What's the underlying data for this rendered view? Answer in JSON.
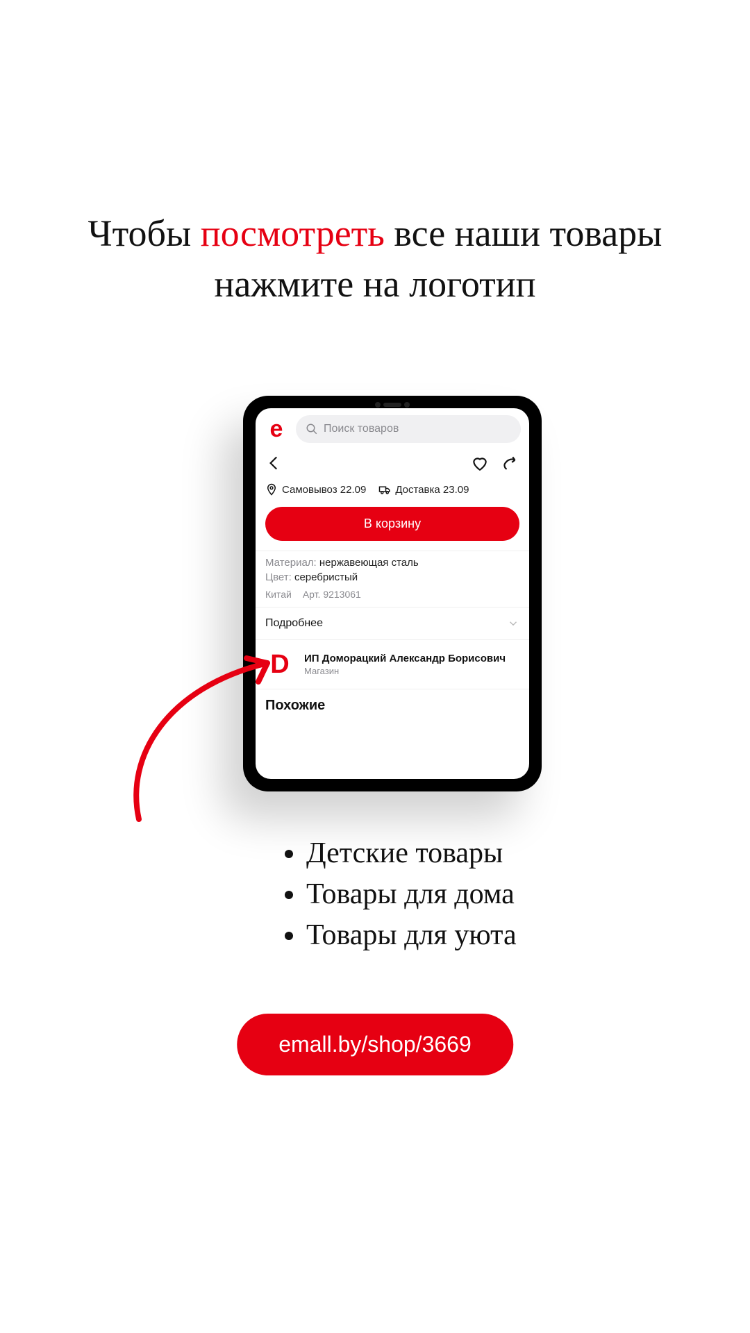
{
  "headline": {
    "part1": "Чтобы ",
    "accent": "посмотреть",
    "part2": " все наши товары",
    "line2": "нажмите на логотип"
  },
  "app": {
    "logo_letter": "e",
    "search_placeholder": "Поиск товаров",
    "pickup_label": "Самовывоз 22.09",
    "delivery_label": "Доставка 23.09",
    "add_to_cart": "В корзину",
    "material_key": "Материал:",
    "material_val": "нержавеющая сталь",
    "color_key": "Цвет:",
    "color_val": "серебристый",
    "origin": "Китай",
    "article_label": "Арт.",
    "article_num": "9213061",
    "more": "Подробнее",
    "store_logo_letter": "D",
    "store_name": "ИП Доморацкий Александр Борисович",
    "store_sub": "Магазин",
    "similar": "Похожие"
  },
  "bullets": [
    "Детские товары",
    "Товары для дома",
    "Товары для уюта"
  ],
  "url": "emall.by/shop/3669"
}
